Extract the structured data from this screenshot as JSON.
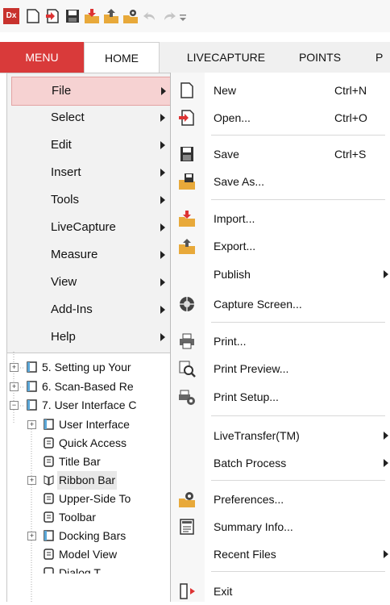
{
  "qat": {
    "app_badge": "Dx"
  },
  "ribbon": {
    "tabs": [
      "MENU",
      "HOME",
      "LIVECAPTURE",
      "POINTS",
      "P"
    ]
  },
  "main_menu": {
    "items": [
      "File",
      "Select",
      "Edit",
      "Insert",
      "Tools",
      "LiveCapture",
      "Measure",
      "View",
      "Add-Ins",
      "Help"
    ],
    "selected": "File"
  },
  "file_menu": {
    "items": [
      {
        "label": "New",
        "shortcut": "Ctrl+N",
        "icon": "new-document-icon"
      },
      {
        "label": "Open...",
        "shortcut": "Ctrl+O",
        "icon": "open-icon"
      },
      {
        "label": "Save",
        "shortcut": "Ctrl+S",
        "icon": "save-icon"
      },
      {
        "label": "Save As...",
        "shortcut": "",
        "icon": "save-as-icon"
      },
      {
        "label": "Import...",
        "shortcut": "",
        "icon": "import-icon"
      },
      {
        "label": "Export...",
        "shortcut": "",
        "icon": "export-icon"
      },
      {
        "label": "Publish",
        "shortcut": "",
        "icon": ""
      },
      {
        "label": "Capture Screen...",
        "shortcut": "",
        "icon": "camera-aperture-icon"
      },
      {
        "label": "Print...",
        "shortcut": "",
        "icon": "printer-icon"
      },
      {
        "label": "Print Preview...",
        "shortcut": "",
        "icon": "print-preview-icon"
      },
      {
        "label": "Print Setup...",
        "shortcut": "",
        "icon": "print-setup-icon"
      },
      {
        "label": "LiveTransfer(TM)",
        "shortcut": "",
        "icon": ""
      },
      {
        "label": "Batch Process",
        "shortcut": "",
        "icon": ""
      },
      {
        "label": "Preferences...",
        "shortcut": "",
        "icon": "preferences-icon"
      },
      {
        "label": "Summary Info...",
        "shortcut": "",
        "icon": "summary-info-icon"
      },
      {
        "label": "Recent Files",
        "shortcut": "",
        "icon": ""
      },
      {
        "label": "Exit",
        "shortcut": "",
        "icon": "exit-icon"
      }
    ]
  },
  "tree": {
    "rows": [
      {
        "label": "5. Setting up Your"
      },
      {
        "label": "6. Scan-Based Re"
      },
      {
        "label": "7. User Interface C"
      },
      {
        "label": "User Interface"
      },
      {
        "label": "Quick Access"
      },
      {
        "label": "Title Bar"
      },
      {
        "label": "Ribbon Bar"
      },
      {
        "label": "Upper-Side To"
      },
      {
        "label": "Toolbar"
      },
      {
        "label": "Docking Bars"
      },
      {
        "label": "Model View"
      },
      {
        "label": "Dialog T"
      }
    ]
  },
  "colors": {
    "menu_tab": "#d93a3a",
    "selected_item_bg": "#f6d2d2",
    "accent_orange": "#e8a93a",
    "accent_red": "#d33"
  }
}
